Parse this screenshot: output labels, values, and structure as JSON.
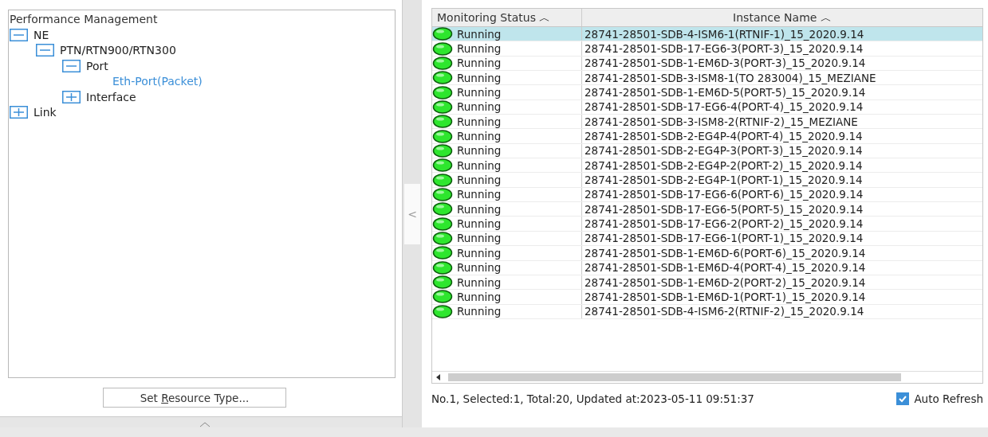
{
  "tree": {
    "title": "Performance Management",
    "items": [
      {
        "label": "NE",
        "expanded": true,
        "selected": false,
        "children": [
          {
            "label": "PTN/RTN900/RTN300",
            "expanded": true,
            "selected": false,
            "children": [
              {
                "label": "Port",
                "expanded": true,
                "selected": false,
                "children": [
                  {
                    "label": "Eth-Port(Packet)",
                    "selected": true
                  }
                ]
              },
              {
                "label": "Interface",
                "expanded": false,
                "selected": false
              }
            ]
          }
        ]
      },
      {
        "label": "Link",
        "expanded": false,
        "selected": false
      }
    ]
  },
  "set_button": {
    "label_parts": [
      {
        "text": "Set ",
        "underlined": false
      },
      {
        "text": "R",
        "underlined": true
      },
      {
        "text": "esource Type...",
        "underlined": false
      }
    ]
  },
  "splitter": {
    "glyph": "<"
  },
  "table": {
    "columns": [
      "Monitoring Status ︿",
      "Instance Name ︿"
    ],
    "rows": [
      {
        "status": "Running",
        "name": "28741-28501-SDB-4-ISM6-1(RTNIF-1)_15_2020.9.14",
        "selected": true
      },
      {
        "status": "Running",
        "name": "28741-28501-SDB-17-EG6-3(PORT-3)_15_2020.9.14",
        "selected": false
      },
      {
        "status": "Running",
        "name": "28741-28501-SDB-1-EM6D-3(PORT-3)_15_2020.9.14",
        "selected": false
      },
      {
        "status": "Running",
        "name": "28741-28501-SDB-3-ISM8-1(TO 283004)_15_MEZIANE",
        "selected": false
      },
      {
        "status": "Running",
        "name": "28741-28501-SDB-1-EM6D-5(PORT-5)_15_2020.9.14",
        "selected": false
      },
      {
        "status": "Running",
        "name": "28741-28501-SDB-17-EG6-4(PORT-4)_15_2020.9.14",
        "selected": false
      },
      {
        "status": "Running",
        "name": "28741-28501-SDB-3-ISM8-2(RTNIF-2)_15_MEZIANE",
        "selected": false
      },
      {
        "status": "Running",
        "name": "28741-28501-SDB-2-EG4P-4(PORT-4)_15_2020.9.14",
        "selected": false
      },
      {
        "status": "Running",
        "name": "28741-28501-SDB-2-EG4P-3(PORT-3)_15_2020.9.14",
        "selected": false
      },
      {
        "status": "Running",
        "name": "28741-28501-SDB-2-EG4P-2(PORT-2)_15_2020.9.14",
        "selected": false
      },
      {
        "status": "Running",
        "name": "28741-28501-SDB-2-EG4P-1(PORT-1)_15_2020.9.14",
        "selected": false
      },
      {
        "status": "Running",
        "name": "28741-28501-SDB-17-EG6-6(PORT-6)_15_2020.9.14",
        "selected": false
      },
      {
        "status": "Running",
        "name": "28741-28501-SDB-17-EG6-5(PORT-5)_15_2020.9.14",
        "selected": false
      },
      {
        "status": "Running",
        "name": "28741-28501-SDB-17-EG6-2(PORT-2)_15_2020.9.14",
        "selected": false
      },
      {
        "status": "Running",
        "name": "28741-28501-SDB-17-EG6-1(PORT-1)_15_2020.9.14",
        "selected": false
      },
      {
        "status": "Running",
        "name": "28741-28501-SDB-1-EM6D-6(PORT-6)_15_2020.9.14",
        "selected": false
      },
      {
        "status": "Running",
        "name": "28741-28501-SDB-1-EM6D-4(PORT-4)_15_2020.9.14",
        "selected": false
      },
      {
        "status": "Running",
        "name": "28741-28501-SDB-1-EM6D-2(PORT-2)_15_2020.9.14",
        "selected": false
      },
      {
        "status": "Running",
        "name": "28741-28501-SDB-1-EM6D-1(PORT-1)_15_2020.9.14",
        "selected": false
      },
      {
        "status": "Running",
        "name": "28741-28501-SDB-4-ISM6-2(RTNIF-2)_15_2020.9.14",
        "selected": false
      }
    ]
  },
  "status_text": "No.1, Selected:1, Total:20, Updated at:2023-05-11 09:51:37",
  "auto_refresh": {
    "label": "Auto Refresh",
    "checked": true
  }
}
